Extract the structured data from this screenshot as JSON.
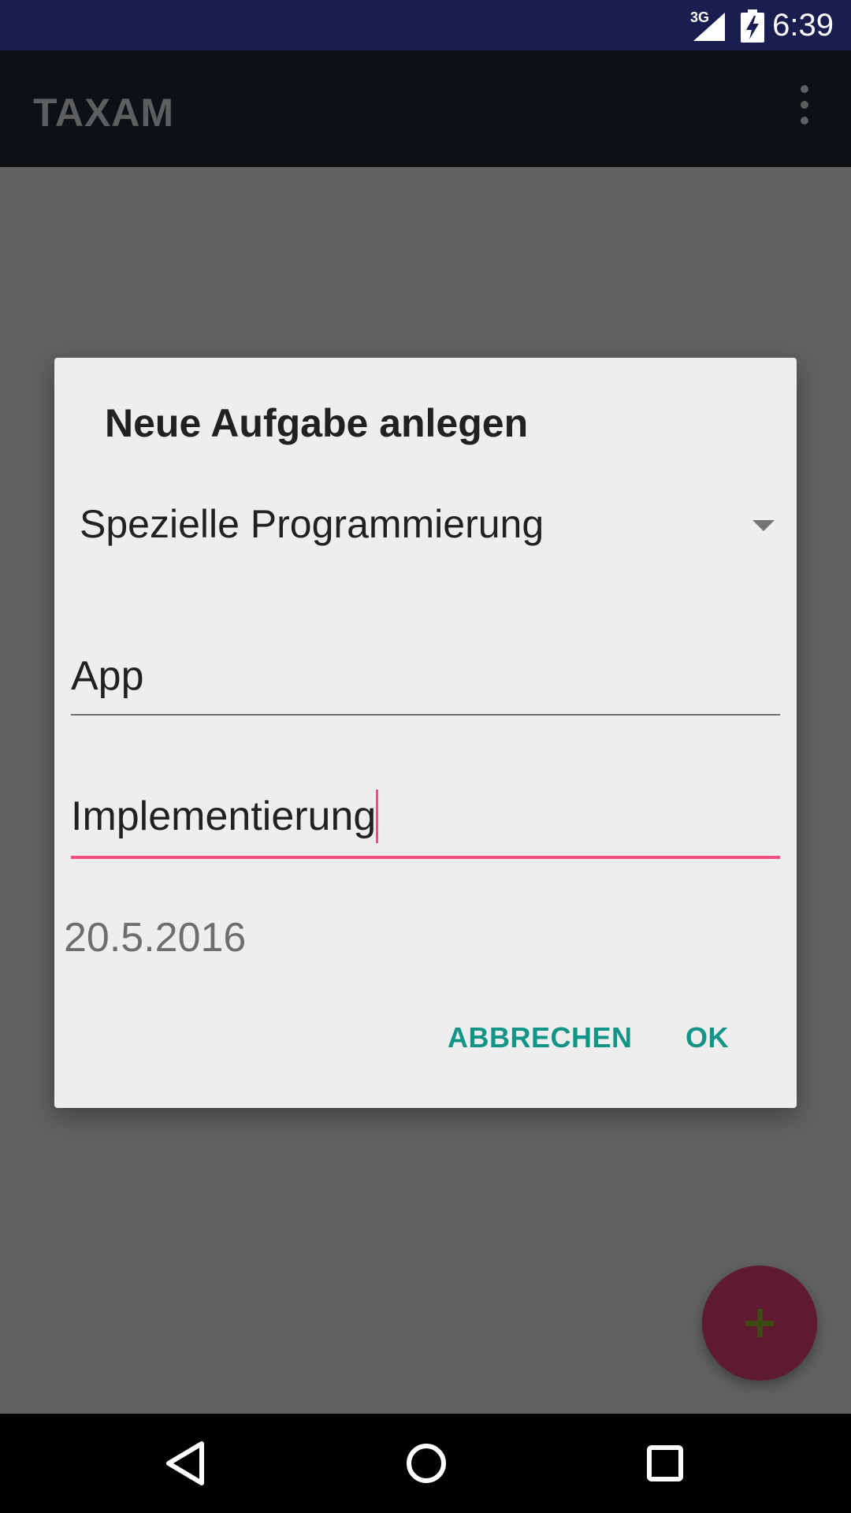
{
  "status_bar": {
    "network": "3G",
    "time": "6:39"
  },
  "app_bar": {
    "title": "TAXAM",
    "overflow_icon": "more-vert-icon"
  },
  "dialog": {
    "title": "Neue Aufgabe anlegen",
    "spinner_value": "Spezielle Programmierung",
    "field_1_value": "App",
    "field_2_value": "Implementierung",
    "date": "20.5.2016",
    "cancel_label": "ABBRECHEN",
    "ok_label": "OK"
  },
  "fab": {
    "icon": "plus-icon"
  },
  "colors": {
    "accent": "#ee4d86",
    "button_text": "#129486",
    "status_bar": "#1a1d50",
    "fab": "#5f1a33"
  }
}
